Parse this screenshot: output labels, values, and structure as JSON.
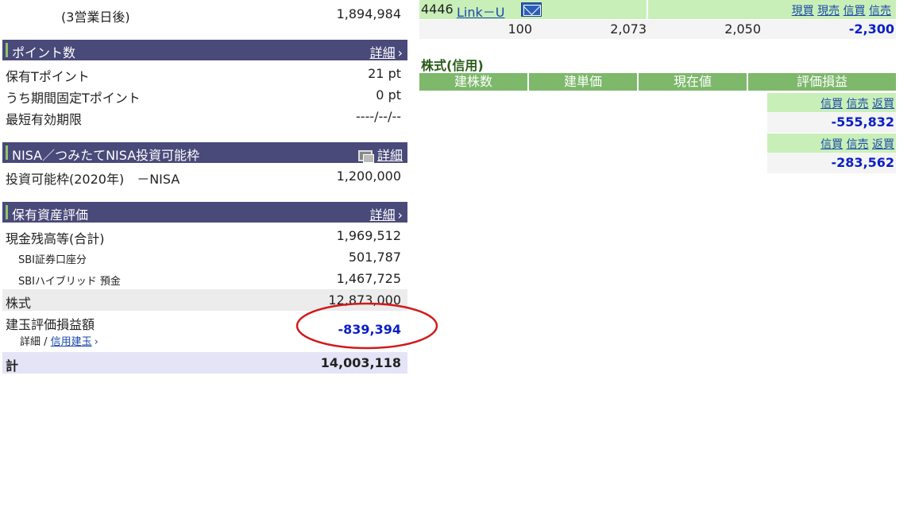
{
  "top": {
    "label": "(3営業日後)",
    "value": "1,894,984"
  },
  "points": {
    "title": "ポイント数",
    "detail": "詳細",
    "rows": [
      {
        "label": "保有Tポイント",
        "value": "21 pt"
      },
      {
        "label": "うち期間固定Tポイント",
        "value": "0 pt"
      },
      {
        "label": "最短有効期限",
        "value": "----/--/--"
      }
    ]
  },
  "nisa": {
    "title": "NISA／つみたてNISA投資可能枠",
    "detail": "詳細",
    "row_label": "投資可能枠(2020年)　－NISA",
    "row_value": "1,200,000"
  },
  "assets": {
    "title": "保有資産評価",
    "detail": "詳細",
    "cash_label": "現金残高等(合計)",
    "cash_value": "1,969,512",
    "sbi_label": "SBI証券口座分",
    "sbi_value": "501,787",
    "hybrid_label": "SBIハイブリッド 預金",
    "hybrid_value": "1,467,725",
    "stock_label": "株式",
    "stock_value": "12,873,000",
    "pl_label": "建玉評価損益額",
    "pl_value": "-839,394",
    "sub_label": "詳細 /",
    "sub_link": "信用建玉",
    "total_label": "計",
    "total_value": "14,003,118"
  },
  "stock_row": {
    "code": "4446",
    "name": "Link－U",
    "links": [
      "現買",
      "現売",
      "信買",
      "信売"
    ],
    "qty": "100",
    "price1": "2,073",
    "price2": "2,050",
    "pl": "-2,300"
  },
  "margin": {
    "title": "株式(信用)",
    "headers": [
      "建株数",
      "建単価",
      "現在値",
      "評価損益"
    ],
    "groups": [
      {
        "links": [
          "信買",
          "信売",
          "返買"
        ],
        "value": "-555,832"
      },
      {
        "links": [
          "信買",
          "信売",
          "返買"
        ],
        "value": "-283,562"
      }
    ]
  },
  "colors": {
    "section_header": "#49497a",
    "green_header": "#7db86b",
    "light_green": "#c9efb9",
    "negative": "#0a1fc4",
    "annotation": "#d11a1a"
  }
}
